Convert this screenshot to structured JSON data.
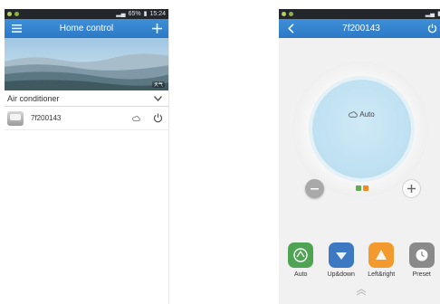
{
  "home_screen": {
    "status": {
      "battery": "65%",
      "time": "15:24"
    },
    "title": "Home control",
    "banner_tag": "天气",
    "section": {
      "label": "Air conditioner"
    },
    "devices": [
      {
        "name": "7f200143"
      }
    ]
  },
  "device_screen": {
    "title": "7f200143",
    "mode_label": "Auto",
    "indicator_colors": [
      "#5cae4e",
      "#f08a24"
    ],
    "modes": [
      {
        "label": "Auto",
        "color": "#4fa454"
      },
      {
        "label": "Up&down",
        "color": "#3d79c2"
      },
      {
        "label": "Left&right",
        "color": "#f29a2e"
      },
      {
        "label": "Preset",
        "color": "#8a8a8a"
      }
    ]
  },
  "colors": {
    "titlebar": "#3584d0",
    "statusbar": "#23262b",
    "accent": "#3584d0"
  },
  "icons": [
    "menu-icon",
    "plus-icon",
    "chevron-down-icon",
    "cloud-icon",
    "power-icon",
    "back-icon",
    "minus-icon",
    "chevron-up-icon"
  ]
}
